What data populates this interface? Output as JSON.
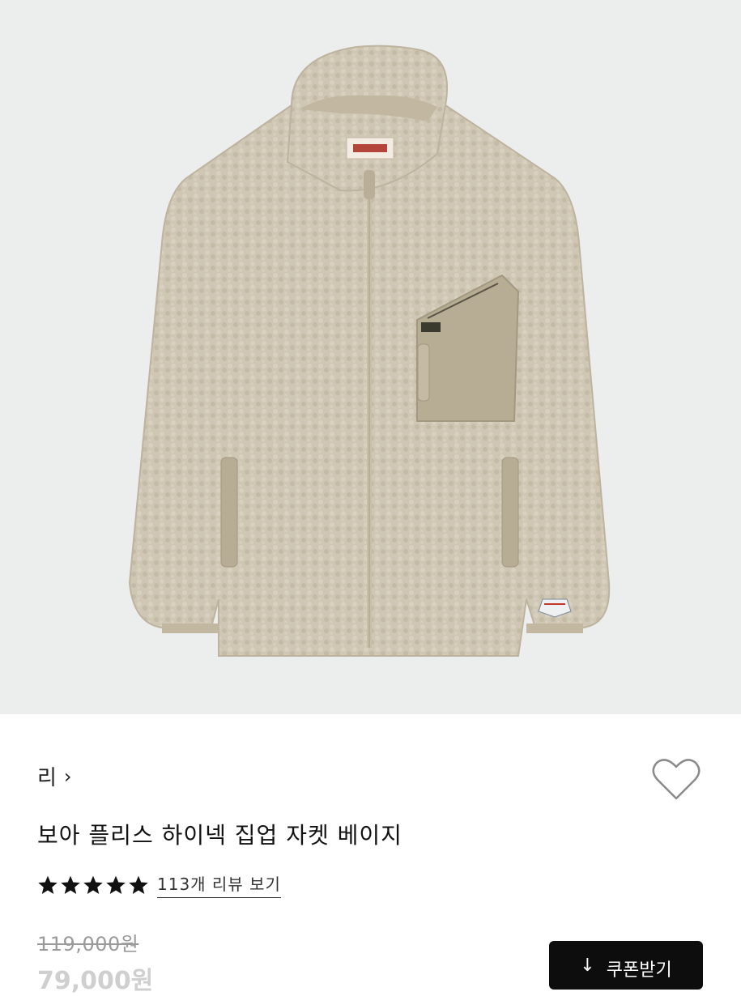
{
  "product_image": {
    "alt_color_bg": "#eceded",
    "fleece_color": "#cdc4b2",
    "nylon_color": "#b5aa92"
  },
  "brand": {
    "label": "리",
    "chevron": "›"
  },
  "product": {
    "title": "보아 플리스 하이넥 집업 자켓 베이지"
  },
  "rating": {
    "stars": 5,
    "review_link": "113개 리뷰 보기"
  },
  "pricing": {
    "original_price": "119,000원",
    "sale_price": "79,000원"
  },
  "coupon": {
    "label": "쿠폰받기",
    "icon": "download-arrow-icon",
    "arrow": "↓"
  },
  "icons": {
    "favorite": "heart-outline-icon",
    "star": "star-icon"
  }
}
